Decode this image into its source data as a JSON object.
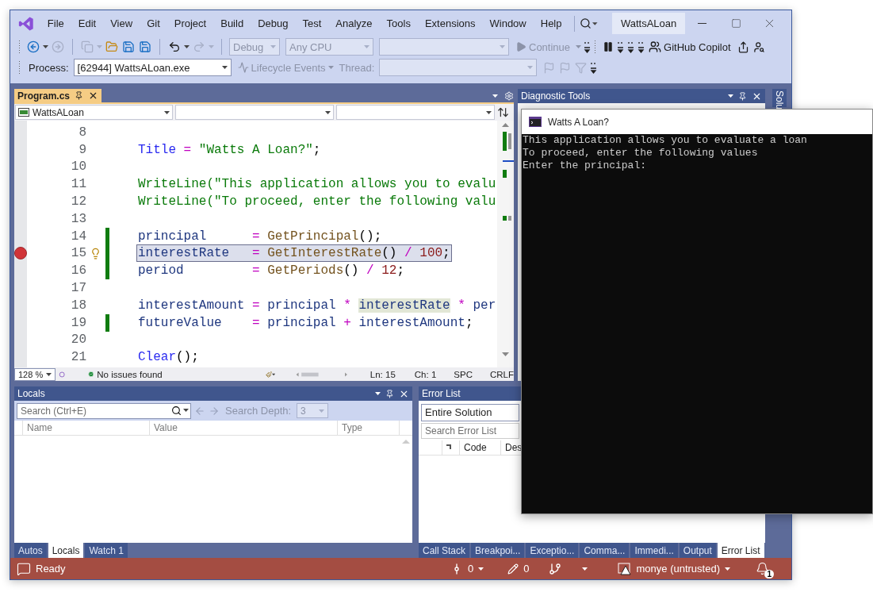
{
  "window": {
    "title": "WattsALoan"
  },
  "menu": [
    "File",
    "Edit",
    "View",
    "Git",
    "Project",
    "Build",
    "Debug",
    "Test",
    "Analyze",
    "Tools",
    "Extensions",
    "Window",
    "Help"
  ],
  "toolbar": {
    "configuration": {
      "value": "Debug",
      "disabled": true
    },
    "platform": {
      "value": "Any CPU",
      "disabled": true
    },
    "continue": {
      "label": "Continue",
      "disabled": true
    },
    "copilot": "GitHub Copilot"
  },
  "debug_bar": {
    "process_label": "Process:",
    "process": "[62944] WattsALoan.exe",
    "lifecycle": {
      "label": "Lifecycle Events",
      "disabled": true
    },
    "thread_label": "Thread:"
  },
  "editor": {
    "tab": "Program.cs",
    "type_dropdown": "WattsALoan",
    "lines": [
      {
        "number": "8",
        "changed": false,
        "breakpoint": false,
        "current": false
      },
      {
        "number": "9",
        "changed": false,
        "breakpoint": false,
        "current": false,
        "segments": [
          {
            "text": "Title",
            "kind": "static"
          },
          {
            "text": " = ",
            "kind": "operator"
          },
          {
            "text": "\"Watts A Loan?\"",
            "kind": "string"
          },
          {
            "text": ";",
            "kind": "plain"
          }
        ]
      },
      {
        "number": "10",
        "changed": false,
        "breakpoint": false,
        "current": false
      },
      {
        "number": "11",
        "changed": false,
        "breakpoint": false,
        "current": false,
        "segments": [
          {
            "text": "WriteLine(",
            "kind": "call"
          },
          {
            "text": "\"This application allows you to evalu",
            "kind": "string"
          }
        ]
      },
      {
        "number": "12",
        "changed": false,
        "breakpoint": false,
        "current": false,
        "segments": [
          {
            "text": "WriteLine(",
            "kind": "call"
          },
          {
            "text": "\"To proceed, enter the following valu",
            "kind": "string"
          }
        ]
      },
      {
        "number": "13",
        "changed": false,
        "breakpoint": false,
        "current": false
      },
      {
        "number": "14",
        "changed": true,
        "breakpoint": false,
        "current": false,
        "segments": [
          {
            "text": "principal",
            "kind": "variable"
          },
          {
            "text": "      = ",
            "kind": "operator"
          },
          {
            "text": "GetPrincipal",
            "kind": "method"
          },
          {
            "text": "();",
            "kind": "plain"
          }
        ]
      },
      {
        "number": "15",
        "changed": true,
        "breakpoint": true,
        "current": true,
        "segments": [
          {
            "text": "interestRate",
            "kind": "variable"
          },
          {
            "text": "   = ",
            "kind": "operator"
          },
          {
            "text": "GetInterestRate",
            "kind": "method"
          },
          {
            "text": "() ",
            "kind": "plain"
          },
          {
            "text": "/ ",
            "kind": "operator"
          },
          {
            "text": "100",
            "kind": "number"
          },
          {
            "text": ";",
            "kind": "plain"
          }
        ]
      },
      {
        "number": "16",
        "changed": true,
        "breakpoint": false,
        "current": false,
        "segments": [
          {
            "text": "period",
            "kind": "variable"
          },
          {
            "text": "         = ",
            "kind": "operator"
          },
          {
            "text": "GetPeriods",
            "kind": "method"
          },
          {
            "text": "() ",
            "kind": "plain"
          },
          {
            "text": "/ ",
            "kind": "operator"
          },
          {
            "text": "12",
            "kind": "number"
          },
          {
            "text": ";",
            "kind": "plain"
          }
        ]
      },
      {
        "number": "17",
        "changed": false,
        "breakpoint": false,
        "current": false
      },
      {
        "number": "18",
        "changed": false,
        "breakpoint": false,
        "current": false,
        "segments": [
          {
            "text": "interestAmount",
            "kind": "variable"
          },
          {
            "text": " = ",
            "kind": "operator"
          },
          {
            "text": "principal",
            "kind": "variable"
          },
          {
            "text": " * ",
            "kind": "operator"
          },
          {
            "text": "interestRate",
            "kind": "reference"
          },
          {
            "text": " * ",
            "kind": "operator"
          },
          {
            "text": "per",
            "kind": "variable"
          }
        ]
      },
      {
        "number": "19",
        "changed": true,
        "breakpoint": false,
        "current": false,
        "segments": [
          {
            "text": "futureValue",
            "kind": "variable"
          },
          {
            "text": "    = ",
            "kind": "operator"
          },
          {
            "text": "principal",
            "kind": "variable"
          },
          {
            "text": " + ",
            "kind": "operator"
          },
          {
            "text": "interestAmount",
            "kind": "variable"
          },
          {
            "text": ";",
            "kind": "plain"
          }
        ]
      },
      {
        "number": "20",
        "changed": false,
        "breakpoint": false,
        "current": false
      },
      {
        "number": "21",
        "changed": false,
        "breakpoint": false,
        "current": false,
        "segments": [
          {
            "text": "Clear",
            "kind": "static"
          },
          {
            "text": "();",
            "kind": "plain"
          }
        ]
      }
    ],
    "zoom": "128 %",
    "health": "No issues found",
    "line": "Ln: 15",
    "column": "Ch: 1",
    "whitespace": "SPC",
    "line_ending": "CRLF"
  },
  "diagnostics": {
    "title": "Diagnostic Tools"
  },
  "side_tab": "Solu",
  "console": {
    "title": "Watts A Loan?",
    "lines": [
      "This application allows you to evaluate a loan",
      "To proceed, enter the following values",
      "Enter the principal:"
    ]
  },
  "locals": {
    "title": "Locals",
    "placeholder": "Search (Ctrl+E)",
    "depth_label": "Search Depth:",
    "depth": "3",
    "columns": [
      "Name",
      "Value",
      "Type"
    ]
  },
  "locals_tabs": [
    {
      "label": "Autos",
      "selected": false
    },
    {
      "label": "Locals",
      "selected": true
    },
    {
      "label": "Watch 1",
      "selected": false
    }
  ],
  "error_list": {
    "title": "Error List",
    "scope": "Entire Solution",
    "placeholder": "Search Error List",
    "columns": [
      "Code",
      "Des"
    ]
  },
  "error_tabs": [
    {
      "label": "Call Stack",
      "selected": false
    },
    {
      "label": "Breakpoi...",
      "selected": false
    },
    {
      "label": "Exceptio...",
      "selected": false
    },
    {
      "label": "Comma...",
      "selected": false
    },
    {
      "label": "Immedi...",
      "selected": false
    },
    {
      "label": "Output",
      "selected": false
    },
    {
      "label": "Error List",
      "selected": true
    }
  ],
  "status_bar": {
    "text": "Ready",
    "commits": "0",
    "changes": "0",
    "user": "monye (untrusted)",
    "notifications": "1"
  }
}
